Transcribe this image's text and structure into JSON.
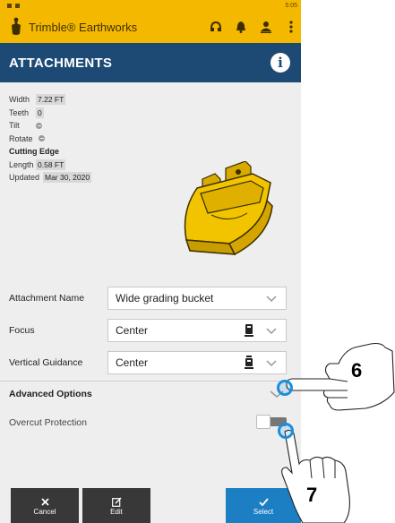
{
  "status": {
    "time": "5:05"
  },
  "app": {
    "title": "Trimble® Earthworks",
    "icons": [
      "headset-icon",
      "bell-icon",
      "person-alert-icon",
      "more-vertical-icon"
    ]
  },
  "page": {
    "title": "ATTACHMENTS",
    "info_icon": "info-icon"
  },
  "specs": {
    "width_label": "Width",
    "width_value": "7.22 FT",
    "teeth_label": "Teeth",
    "teeth_value": "0",
    "tilt_label": "Tilt",
    "rotate_label": "Rotate",
    "cutting_edge_heading": "Cutting Edge",
    "length_label": "Length",
    "length_value": "0.58 FT",
    "updated_label": "Updated",
    "updated_value": "Mar 30, 2020"
  },
  "fields": {
    "attachment_name_label": "Attachment Name",
    "attachment_name_value": "Wide grading bucket",
    "focus_label": "Focus",
    "focus_value": "Center",
    "vertical_guidance_label": "Vertical Guidance",
    "vertical_guidance_value": "Center"
  },
  "advanced": {
    "label": "Advanced Options",
    "expanded": false
  },
  "overcut": {
    "label": "Overcut Protection",
    "enabled": false
  },
  "buttons": {
    "cancel": "Cancel",
    "edit": "Edit",
    "select": "Select"
  },
  "callouts": {
    "six": "6",
    "seven": "7"
  },
  "colors": {
    "brand_yellow": "#f5b800",
    "header_blue": "#1d4a75",
    "select_blue": "#1d7fc3",
    "callout_blue": "#1a8fe0",
    "bucket_yellow": "#f2c400"
  }
}
